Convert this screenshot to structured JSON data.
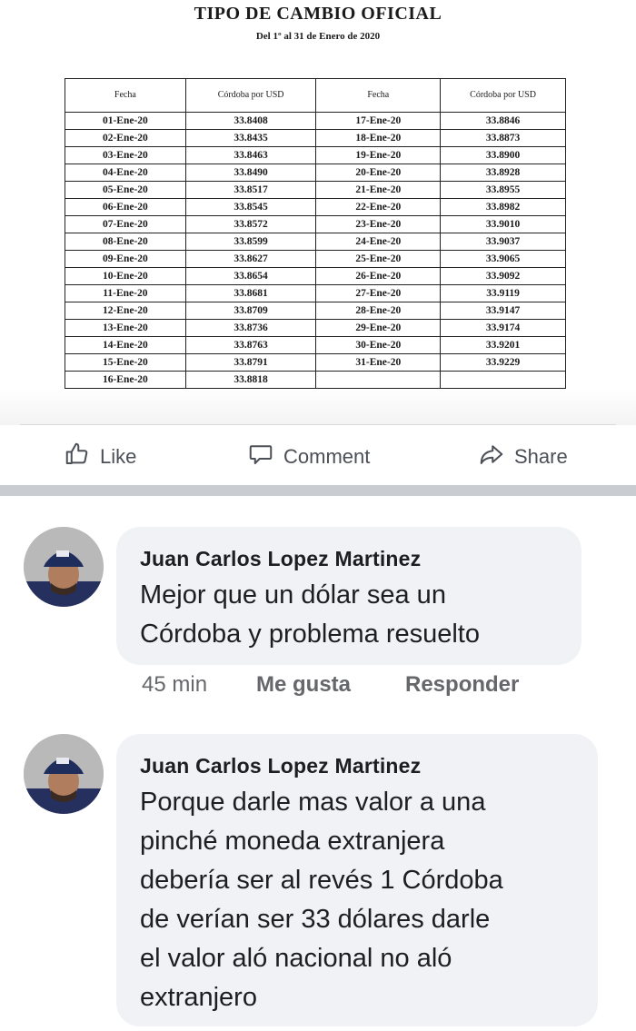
{
  "document": {
    "title": "TIPO DE CAMBIO OFICIAL",
    "subtitle": "Del 1º al 31 de Enero de 2020",
    "headers": [
      "Fecha",
      "Córdoba por USD",
      "Fecha",
      "Córdoba por USD"
    ],
    "left_rows": [
      [
        "01-Ene-20",
        "33.8408"
      ],
      [
        "02-Ene-20",
        "33.8435"
      ],
      [
        "03-Ene-20",
        "33.8463"
      ],
      [
        "04-Ene-20",
        "33.8490"
      ],
      [
        "05-Ene-20",
        "33.8517"
      ],
      [
        "06-Ene-20",
        "33.8545"
      ],
      [
        "07-Ene-20",
        "33.8572"
      ],
      [
        "08-Ene-20",
        "33.8599"
      ],
      [
        "09-Ene-20",
        "33.8627"
      ],
      [
        "10-Ene-20",
        "33.8654"
      ],
      [
        "11-Ene-20",
        "33.8681"
      ],
      [
        "12-Ene-20",
        "33.8709"
      ],
      [
        "13-Ene-20",
        "33.8736"
      ],
      [
        "14-Ene-20",
        "33.8763"
      ],
      [
        "15-Ene-20",
        "33.8791"
      ],
      [
        "16-Ene-20",
        "33.8818"
      ]
    ],
    "right_rows": [
      [
        "17-Ene-20",
        "33.8846"
      ],
      [
        "18-Ene-20",
        "33.8873"
      ],
      [
        "19-Ene-20",
        "33.8900"
      ],
      [
        "20-Ene-20",
        "33.8928"
      ],
      [
        "21-Ene-20",
        "33.8955"
      ],
      [
        "22-Ene-20",
        "33.8982"
      ],
      [
        "23-Ene-20",
        "33.9010"
      ],
      [
        "24-Ene-20",
        "33.9037"
      ],
      [
        "25-Ene-20",
        "33.9065"
      ],
      [
        "26-Ene-20",
        "33.9092"
      ],
      [
        "27-Ene-20",
        "33.9119"
      ],
      [
        "28-Ene-20",
        "33.9147"
      ],
      [
        "29-Ene-20",
        "33.9174"
      ],
      [
        "30-Ene-20",
        "33.9201"
      ],
      [
        "31-Ene-20",
        "33.9229"
      ],
      [
        "",
        ""
      ]
    ]
  },
  "actions": {
    "like": "Like",
    "comment": "Comment",
    "share": "Share",
    "icons": [
      "thumbs-up-icon",
      "comment-icon",
      "share-icon"
    ]
  },
  "comments": [
    {
      "author": "Juan Carlos Lopez Martinez",
      "lines": [
        "Mejor que un dólar sea un",
        "Córdoba y problema resuelto"
      ],
      "time": "45 min",
      "like": "Me gusta",
      "reply": "Responder"
    },
    {
      "author": "Juan Carlos Lopez Martinez",
      "lines": [
        "Porque darle mas valor a una",
        "pinché moneda extranjera",
        "debería ser al revés 1 Córdoba",
        "de verían ser 33 dólares darle",
        "el valor aló nacional no aló",
        "extranjero"
      ]
    }
  ],
  "colors": {
    "action_text": "#4b4f56",
    "bubble": "#f0f2f5",
    "meta": "#65676b",
    "separator": "#c9ccd1"
  }
}
